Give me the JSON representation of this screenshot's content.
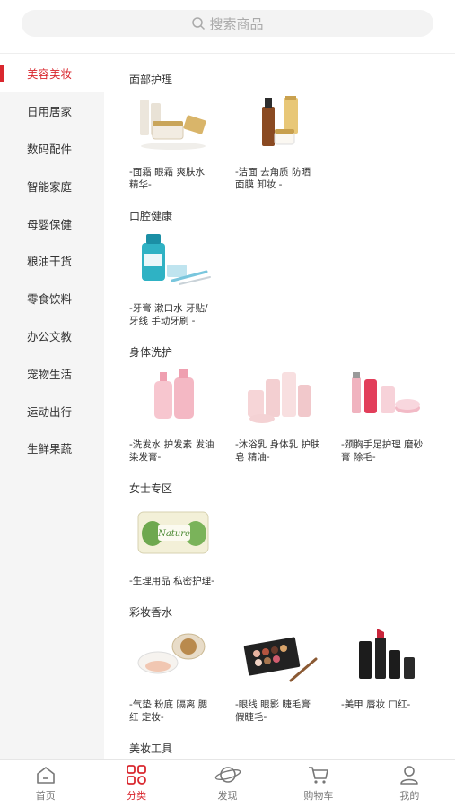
{
  "search": {
    "placeholder": "搜索商品"
  },
  "sidebar": {
    "items": [
      {
        "label": "美容美妆"
      },
      {
        "label": "日用居家"
      },
      {
        "label": "数码配件"
      },
      {
        "label": "智能家庭"
      },
      {
        "label": "母婴保健"
      },
      {
        "label": "粮油干货"
      },
      {
        "label": "零食饮料"
      },
      {
        "label": "办公文教"
      },
      {
        "label": "宠物生活"
      },
      {
        "label": "运动出行"
      },
      {
        "label": "生鲜果蔬"
      }
    ]
  },
  "sections": [
    {
      "title": "面部护理",
      "products": [
        {
          "label": "-面霜 眼霜 爽肤水 精华-"
        },
        {
          "label": "-洁面 去角质 防晒 面膜 卸妆 -"
        }
      ]
    },
    {
      "title": "口腔健康",
      "products": [
        {
          "label": "-牙膏 漱口水 牙贴/牙线 手动牙刷 -"
        }
      ]
    },
    {
      "title": "身体洗护",
      "products": [
        {
          "label": "-洗发水 护发素 发油 染发膏-"
        },
        {
          "label": "-沐浴乳 身体乳 护肤皂 精油-"
        },
        {
          "label": "-颈胸手足护理 磨砂膏 除毛-"
        }
      ]
    },
    {
      "title": "女士专区",
      "products": [
        {
          "label": "-生理用品 私密护理-",
          "pack_text": "Nature"
        }
      ]
    },
    {
      "title": "彩妆香水",
      "products": [
        {
          "label": "-气垫 粉底 隔离 腮红 定妆-"
        },
        {
          "label": "-眼线 眼影 睫毛膏 假睫毛-"
        },
        {
          "label": "-美甲 唇妆 口红-"
        }
      ]
    },
    {
      "title": "美妆工具",
      "products": []
    }
  ],
  "tabbar": {
    "items": [
      {
        "label": "首页"
      },
      {
        "label": "分类"
      },
      {
        "label": "发现"
      },
      {
        "label": "购物车"
      },
      {
        "label": "我的"
      }
    ]
  },
  "colors": {
    "accent": "#d9272e",
    "sidebar_bg": "#f5f5f5"
  }
}
